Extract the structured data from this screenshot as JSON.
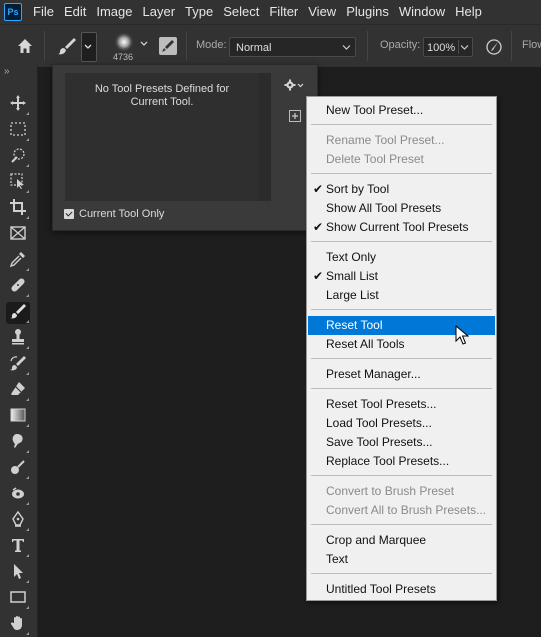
{
  "menubar": {
    "logo": "Ps",
    "items": [
      "File",
      "Edit",
      "Image",
      "Layer",
      "Type",
      "Select",
      "Filter",
      "View",
      "Plugins",
      "Window",
      "Help"
    ]
  },
  "options": {
    "brush_size": "4736",
    "mode_label": "Mode:",
    "mode_value": "Normal",
    "opacity_label": "Opacity:",
    "opacity_value": "100%",
    "flow_label": "Flow"
  },
  "toolbar": {
    "collapse": "»",
    "tools": [
      "move-icon",
      "marquee-icon",
      "quick-select-icon",
      "crop-frame-icon",
      "crop-icon",
      "frame-icon",
      "eyedropper-icon",
      "healing-brush-icon",
      "brush-icon",
      "stamp-icon",
      "history-brush-icon",
      "eraser-icon",
      "gradient-icon",
      "smudge-icon",
      "burn-icon",
      "sponge-icon",
      "pen-icon",
      "type-icon",
      "path-select-icon",
      "rectangle-icon",
      "hand-icon"
    ]
  },
  "presets_panel": {
    "empty_message": "No Tool Presets Defined for Current Tool.",
    "current_only_label": "Current Tool Only",
    "current_only_checked": true
  },
  "context_menu": {
    "items": [
      {
        "label": "New Tool Preset...",
        "enabled": true,
        "checked": false
      },
      {
        "label": "Rename Tool Preset...",
        "enabled": false,
        "checked": false
      },
      {
        "label": "Delete Tool Preset",
        "enabled": false,
        "checked": false
      },
      {
        "label": "Sort by Tool",
        "enabled": true,
        "checked": true
      },
      {
        "label": "Show All Tool Presets",
        "enabled": true,
        "checked": false
      },
      {
        "label": "Show Current Tool Presets",
        "enabled": true,
        "checked": true
      },
      {
        "label": "Text Only",
        "enabled": true,
        "checked": false
      },
      {
        "label": "Small List",
        "enabled": true,
        "checked": true
      },
      {
        "label": "Large List",
        "enabled": true,
        "checked": false
      },
      {
        "label": "Reset Tool",
        "enabled": true,
        "checked": false,
        "highlighted": true
      },
      {
        "label": "Reset All Tools",
        "enabled": true,
        "checked": false
      },
      {
        "label": "Preset Manager...",
        "enabled": true,
        "checked": false
      },
      {
        "label": "Reset Tool Presets...",
        "enabled": true,
        "checked": false
      },
      {
        "label": "Load Tool Presets...",
        "enabled": true,
        "checked": false
      },
      {
        "label": "Save Tool Presets...",
        "enabled": true,
        "checked": false
      },
      {
        "label": "Replace Tool Presets...",
        "enabled": true,
        "checked": false
      },
      {
        "label": "Convert to Brush Preset",
        "enabled": false,
        "checked": false
      },
      {
        "label": "Convert All to Brush Presets...",
        "enabled": false,
        "checked": false
      },
      {
        "label": "Crop and Marquee",
        "enabled": true,
        "checked": false
      },
      {
        "label": "Text",
        "enabled": true,
        "checked": false
      },
      {
        "label": "Untitled Tool Presets",
        "enabled": true,
        "checked": false
      }
    ],
    "check_glyph": "✔"
  },
  "colors": {
    "menu_highlight": "#0078d7",
    "app_background": "#1e1e1e",
    "panel_background": "#3a3a3a"
  }
}
